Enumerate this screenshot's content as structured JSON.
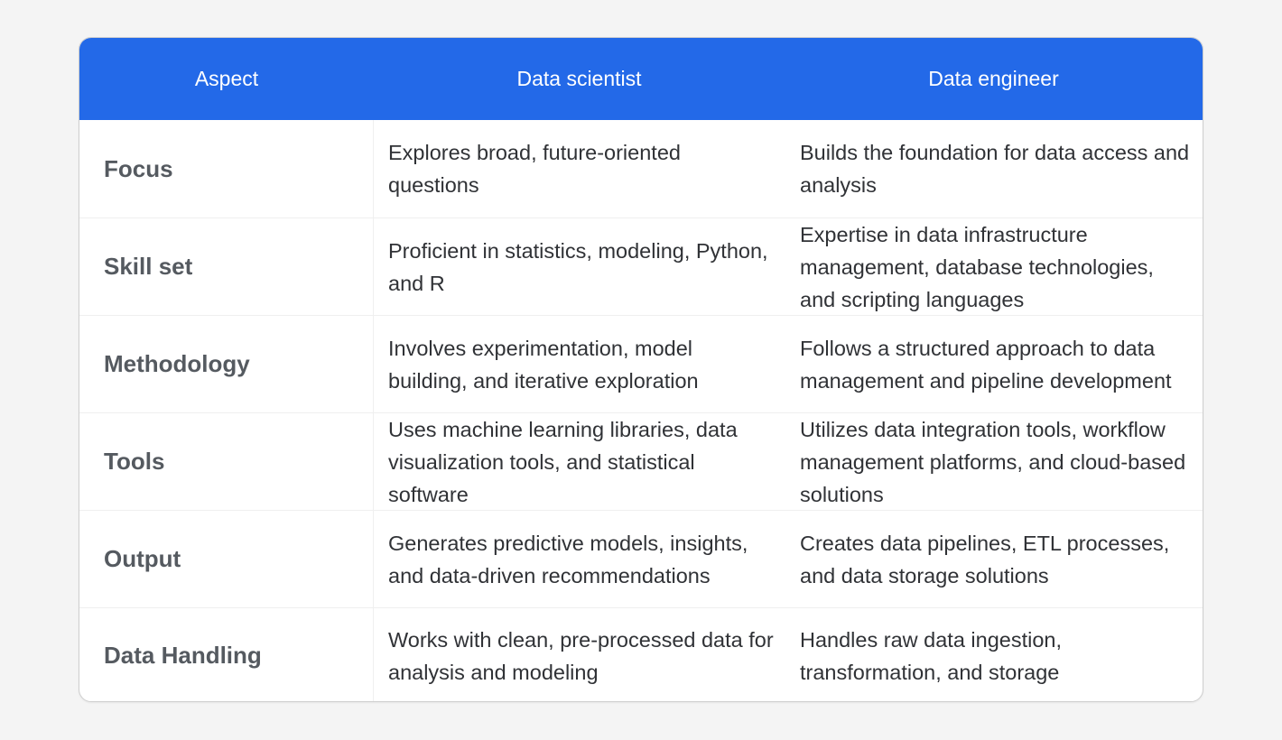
{
  "table": {
    "header_color": "#2369e8",
    "columns": [
      "Aspect",
      "Data scientist",
      "Data engineer"
    ],
    "rows": [
      {
        "aspect": "Focus",
        "data_scientist": "Explores broad, future-oriented questions",
        "data_engineer": "Builds the foundation for data access and analysis"
      },
      {
        "aspect": "Skill set",
        "data_scientist": "Proficient in statistics, modeling, Python, and R",
        "data_engineer": "Expertise in data infrastructure management, database technologies, and scripting languages"
      },
      {
        "aspect": "Methodology",
        "data_scientist": "Involves experimentation, model building, and iterative exploration",
        "data_engineer": "Follows a structured approach to data management and pipeline development"
      },
      {
        "aspect": "Tools",
        "data_scientist": "Uses machine learning libraries, data visualization tools, and statistical software",
        "data_engineer": "Utilizes data integration tools, workflow management platforms, and cloud-based solutions"
      },
      {
        "aspect": "Output",
        "data_scientist": "Generates predictive models, insights, and data-driven recommendations",
        "data_engineer": "Creates data pipelines, ETL processes, and data storage solutions"
      },
      {
        "aspect": "Data Handling",
        "data_scientist": "Works with clean, pre-processed data for analysis and modeling",
        "data_engineer": "Handles raw data ingestion, transformation, and storage"
      }
    ]
  }
}
